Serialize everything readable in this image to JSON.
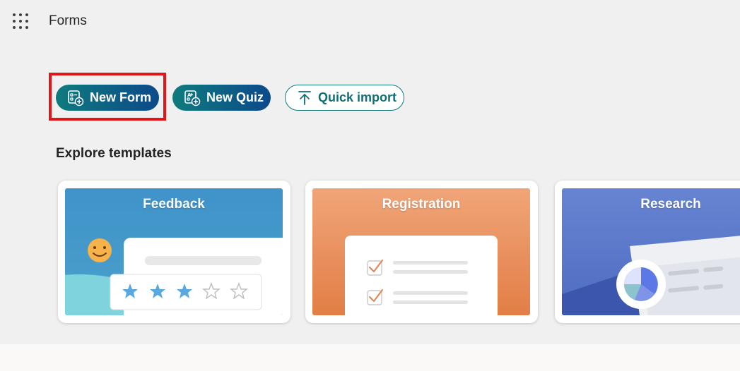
{
  "header": {
    "app_title": "Forms"
  },
  "actions": {
    "new_form": "New Form",
    "new_quiz": "New Quiz",
    "quick_import": "Quick import"
  },
  "templates": {
    "section_title": "Explore templates",
    "cards": [
      {
        "title": "Feedback"
      },
      {
        "title": "Registration"
      },
      {
        "title": "Research"
      }
    ]
  },
  "colors": {
    "primary_gradient_start": "#0f7b7d",
    "primary_gradient_end": "#0b4a8c",
    "highlight": "#e0141b",
    "feedback_bg": "#4196c6",
    "registration_bg": "#e98a57",
    "research_bg": "#5876c8"
  },
  "icons": {
    "app_launcher": "waffle-grid-icon",
    "new_form": "form-add-icon",
    "new_quiz": "quiz-add-icon",
    "quick_import": "upload-arrow-icon"
  }
}
